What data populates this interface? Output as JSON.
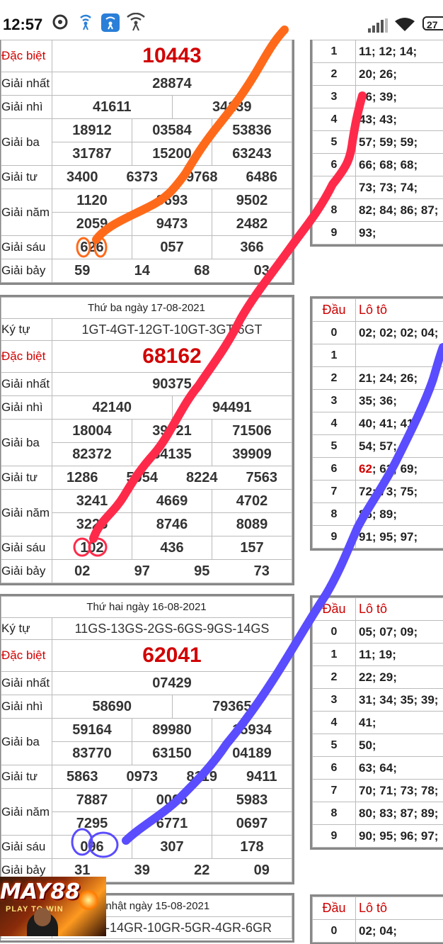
{
  "status_bar": {
    "time": "12:57",
    "battery": "27"
  },
  "tables": [
    {
      "date": "",
      "kytu": "",
      "labels": [
        "Đặc biệt",
        "Giải nhất",
        "Giải nhì",
        "Giải ba",
        "Giải tư",
        "Giải năm",
        "Giải sáu",
        "Giải bảy"
      ],
      "db": "10443",
      "g1": "28874",
      "g2": [
        "41611",
        "34139"
      ],
      "g3": [
        "18912",
        "03584",
        "53836",
        "31787",
        "15200",
        "63243"
      ],
      "g4": [
        "3400",
        "6373",
        "9768",
        "6486"
      ],
      "g5": [
        "1120",
        "8693",
        "9502",
        "2059",
        "9473",
        "2482"
      ],
      "g6": [
        "626",
        "057",
        "366"
      ],
      "g7": [
        "59",
        "14",
        "68",
        "03"
      ]
    },
    {
      "date": "Thứ ba ngày 17-08-2021",
      "kytu_label": "Ký tự",
      "kytu": "1GT-4GT-12GT-10GT-3GT-6GT",
      "labels": [
        "Đặc biệt",
        "Giải nhất",
        "Giải nhì",
        "Giải ba",
        "Giải tư",
        "Giải năm",
        "Giải sáu",
        "Giải bảy"
      ],
      "db": "68162",
      "g1": "90375",
      "g2": [
        "42140",
        "94491"
      ],
      "g3": [
        "18004",
        "39721",
        "71506",
        "82372",
        "84135",
        "39909"
      ],
      "g4": [
        "1286",
        "5054",
        "8224",
        "7563"
      ],
      "g5": [
        "3241",
        "4669",
        "4702",
        "3225",
        "8746",
        "8089"
      ],
      "g6": [
        "102",
        "436",
        "157"
      ],
      "g7": [
        "02",
        "97",
        "95",
        "73"
      ]
    },
    {
      "date": "Thứ hai ngày 16-08-2021",
      "kytu_label": "Ký tự",
      "kytu": "11GS-13GS-2GS-6GS-9GS-14GS",
      "labels": [
        "Đặc biệt",
        "Giải nhất",
        "Giải nhì",
        "Giải ba",
        "Giải tư",
        "Giải năm",
        "Giải sáu",
        "Giải bảy"
      ],
      "db": "62041",
      "g1": "07429",
      "g2": [
        "58690",
        "79365"
      ],
      "g3": [
        "59164",
        "89980",
        "15934",
        "83770",
        "63150",
        "04189"
      ],
      "g4": [
        "5863",
        "0973",
        "8119",
        "9411"
      ],
      "g5": [
        "7887",
        "0005",
        "5983",
        "7295",
        "6771",
        "0697"
      ],
      "g6": [
        "096",
        "307",
        "178"
      ],
      "g7": [
        "31",
        "39",
        "22",
        "09"
      ]
    },
    {
      "date": "Chủ nhật ngày 15-08-2021",
      "kytu": "13GR-14GR-10GR-5GR-4GR-6GR"
    }
  ],
  "loto": [
    {
      "rows": [
        {
          "d": "1",
          "v": "11; 12; 14;"
        },
        {
          "d": "2",
          "v": "20; 26;"
        },
        {
          "d": "3",
          "v": "36; 39;"
        },
        {
          "d": "4",
          "v": "43; 43;"
        },
        {
          "d": "5",
          "v": "57; 59; 59;"
        },
        {
          "d": "6",
          "v": "66; 68; 68;"
        },
        {
          "d": "7",
          "v": "73; 73; 74;"
        },
        {
          "d": "8",
          "v": "82; 84; 86; 87;"
        },
        {
          "d": "9",
          "v": "93;"
        }
      ]
    },
    {
      "head_dau": "Đầu",
      "head_loto": "Lô tô",
      "rows": [
        {
          "d": "0",
          "v": "02; 02; 02; 04;"
        },
        {
          "d": "1",
          "v": ""
        },
        {
          "d": "2",
          "v": "21; 24; 26;"
        },
        {
          "d": "3",
          "v": "35; 36;"
        },
        {
          "d": "4",
          "v": "40; 41; 41;"
        },
        {
          "d": "5",
          "v": "54; 57;"
        },
        {
          "d": "6",
          "v": "62; 63; 69;",
          "red": "62"
        },
        {
          "d": "7",
          "v": "72; 73; 75;"
        },
        {
          "d": "8",
          "v": "86; 89;"
        },
        {
          "d": "9",
          "v": "91; 95; 97;"
        }
      ]
    },
    {
      "head_dau": "Đầu",
      "head_loto": "Lô tô",
      "rows": [
        {
          "d": "0",
          "v": "05; 07; 09;"
        },
        {
          "d": "1",
          "v": "11; 19;"
        },
        {
          "d": "2",
          "v": "22; 29;"
        },
        {
          "d": "3",
          "v": "31; 34; 35; 39;"
        },
        {
          "d": "4",
          "v": "41;",
          "red": "41"
        },
        {
          "d": "5",
          "v": "50;"
        },
        {
          "d": "6",
          "v": "63; 64;"
        },
        {
          "d": "7",
          "v": "70; 71; 73; 78;"
        },
        {
          "d": "8",
          "v": "80; 83; 87; 89;"
        },
        {
          "d": "9",
          "v": "90; 95; 96; 97;"
        }
      ]
    },
    {
      "head_dau": "Đầu",
      "head_loto": "Lô tô",
      "rows": [
        {
          "d": "0",
          "v": "02; 04;"
        }
      ]
    }
  ],
  "ad": {
    "brand": "MAY88",
    "tagline": "PLAY TO WIN"
  },
  "colors": {
    "accent_red": "#d10000",
    "stroke_orange": "#ff6a1a",
    "stroke_red": "#ff2a4a",
    "stroke_blue": "#5a4cff"
  }
}
